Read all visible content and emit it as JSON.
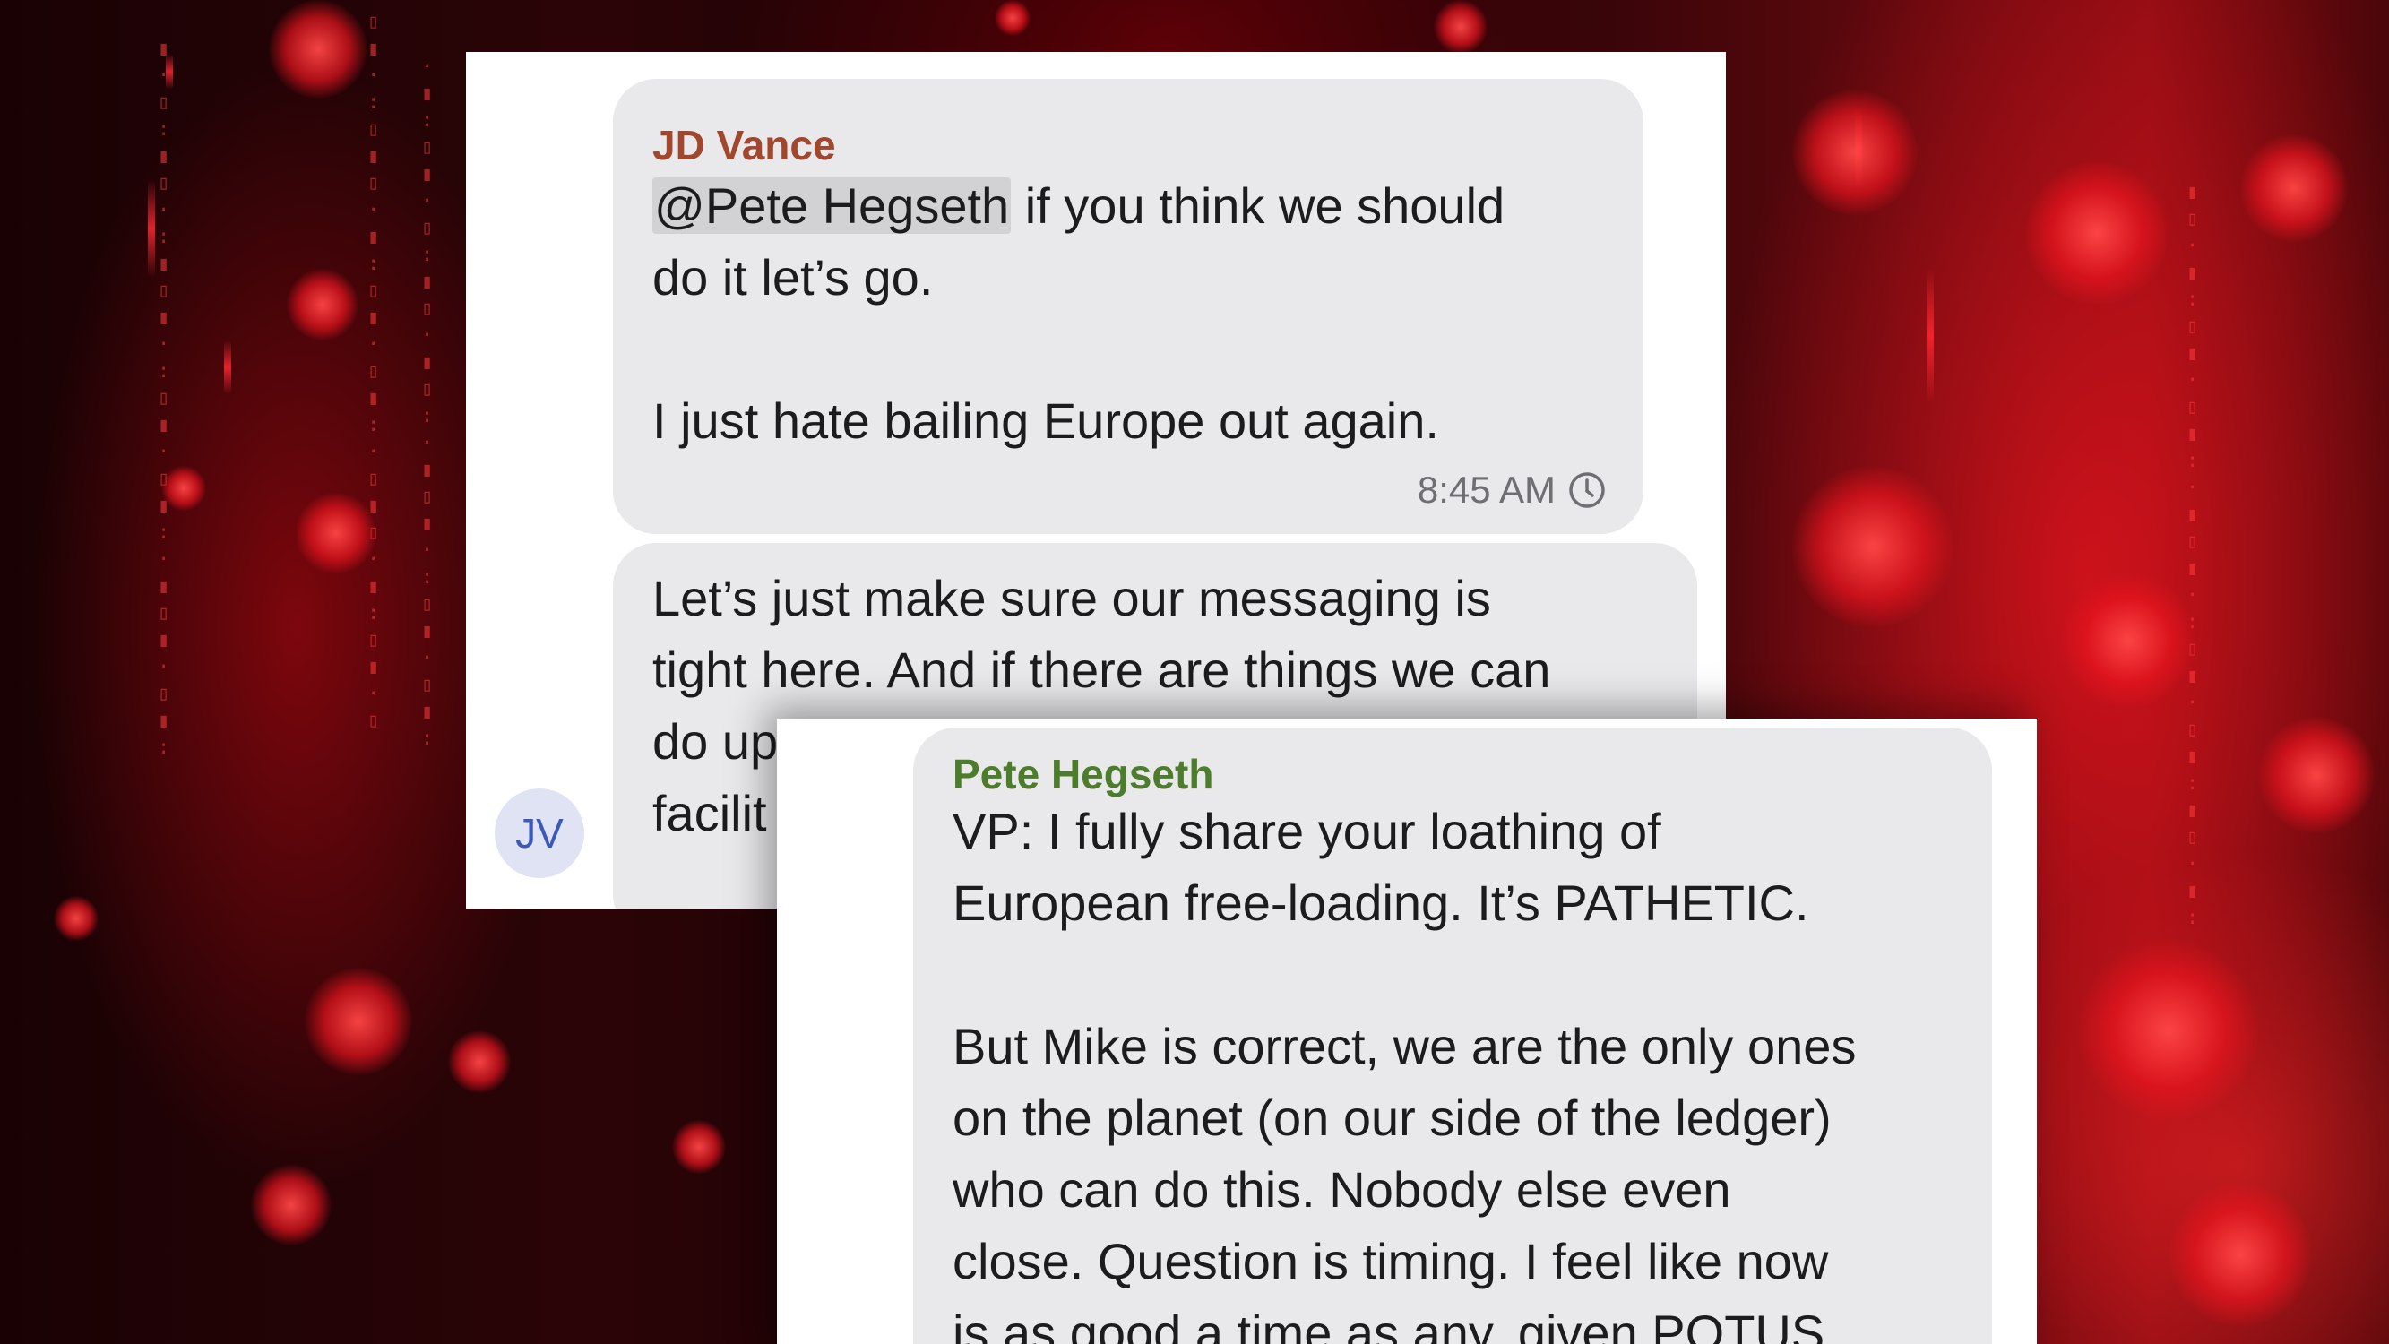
{
  "messages": [
    {
      "sender": "JD Vance",
      "sender_color": "#a0472d",
      "mention": "@Pete Hegseth",
      "line1_rest": " if you think we should",
      "line2": "do it let’s go.",
      "paragraph2": "I just hate bailing Europe out again.",
      "timestamp": "8:45 AM",
      "status_icon": "clock-icon"
    },
    {
      "sender": "",
      "lines": [
        "Let’s just make sure our messaging is",
        "tight here. And if there are things we can",
        "do up",
        "facilit"
      ],
      "avatar_initials": "JV"
    },
    {
      "sender": "Pete Hegseth",
      "sender_color": "#4c7d2a",
      "paragraph1": [
        "VP: I fully share your loathing of",
        "European free-loading. It’s PATHETIC."
      ],
      "paragraph2": [
        "But Mike is correct, we are the only ones",
        "on the planet (on our side of the ledger)",
        "who can do this. Nobody else even",
        "close. Question is timing. I feel like now",
        "is as good a time as any, given POTUS"
      ]
    }
  ],
  "theme": {
    "bubble_bg": "#e9e9eb",
    "background_accent": "#e0141e"
  }
}
